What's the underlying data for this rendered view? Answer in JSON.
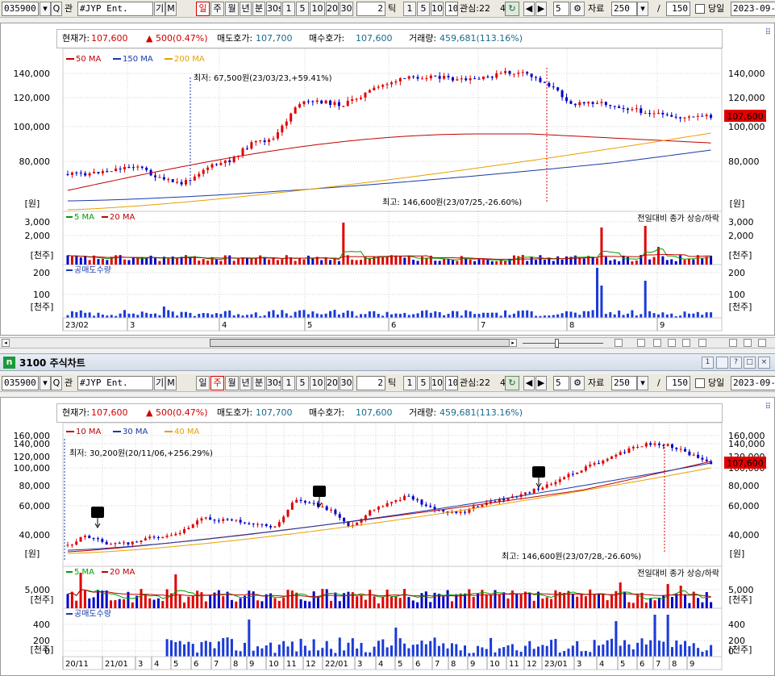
{
  "toolbar": {
    "code": "035900",
    "search_glyph": "Q",
    "search_label": "관",
    "name": "#JYP Ent.",
    "flag1": "기",
    "flag2": "M",
    "periods": [
      "일",
      "주",
      "월",
      "년",
      "분",
      "30s",
      "1",
      "5",
      "10",
      "20",
      "30"
    ],
    "tick_value": "2",
    "tick_label": "틱",
    "tick_buttons": [
      "1",
      "5",
      "10"
    ],
    "tick_input": "10",
    "interest": "관심:22",
    "interest_suffix": "4",
    "count": "5",
    "data_label": "자료",
    "data_value": "250",
    "slash": "/",
    "total": "150",
    "today_label": "당일",
    "date": "2023-09-1"
  },
  "chart1": {
    "period_selected": "일",
    "info": {
      "price_label": "현재가:",
      "price": "107,600",
      "change_arrow": "▲",
      "change": "500(0.47%)",
      "ask_label": "매도호가:",
      "ask": "107,700",
      "bid_label": "매수호가:",
      "bid": "107,600",
      "vol_label": "거래량:",
      "vol": "459,681(113.16%)"
    },
    "ma_legend": [
      {
        "label": "50 MA",
        "color": "#c00000"
      },
      {
        "label": "150 MA",
        "color": "#1a3aa8"
      },
      {
        "label": "200 MA",
        "color": "#e8a000"
      }
    ],
    "price_ticks": [
      "140,000",
      "120,000",
      "100,000",
      "80,000"
    ],
    "unit_won": "[원]",
    "current_tag": "107,600",
    "low_note": "최저: 67,500원(23/03/23,+59.41%)",
    "high_note": "최고: 146,600원(23/07/25,-26.60%)",
    "vol_legend": [
      {
        "label": "5 MA",
        "color": "#00a000"
      },
      {
        "label": "20 MA",
        "color": "#c00000"
      }
    ],
    "vol_right_note": "전일대비 종가 상승/하락",
    "vol_ticks": [
      "3,000",
      "2,000"
    ],
    "unit_thousand": "[천주]",
    "short_label": "공매도수량",
    "short_ticks": [
      "200",
      "100"
    ],
    "x_labels": [
      "23/02",
      "3",
      "4",
      "5",
      "6",
      "7",
      "8",
      "9"
    ]
  },
  "window": {
    "icon": "n",
    "title": "3100 주식차트",
    "buttons": [
      "1",
      "?",
      "□",
      "×"
    ]
  },
  "chart2": {
    "period_selected": "주",
    "info": {
      "price_label": "현재가:",
      "price": "107,600",
      "change_arrow": "▲",
      "change": "500(0.47%)",
      "ask_label": "매도호가:",
      "ask": "107,700",
      "bid_label": "매수호가:",
      "bid": "107,600",
      "vol_label": "거래량:",
      "vol": "459,681(113.16%)"
    },
    "ma_legend": [
      {
        "label": "10 MA",
        "color": "#c00000"
      },
      {
        "label": "30 MA",
        "color": "#1a3aa8"
      },
      {
        "label": "40 MA",
        "color": "#e8a000"
      }
    ],
    "price_ticks": [
      "160,000",
      "140,000",
      "120,000",
      "100,000",
      "80,000",
      "60,000",
      "40,000"
    ],
    "unit_won": "[원]",
    "current_tag": "107,600",
    "low_note": "최저: 30,200원(20/11/06,+256.29%)",
    "high_note": "최고: 146,600원(23/07/28,-26.60%)",
    "marker": "매",
    "vol_legend": [
      {
        "label": "5 MA",
        "color": "#00a000"
      },
      {
        "label": "20 MA",
        "color": "#c00000"
      }
    ],
    "vol_right_note": "전일대비 종가 상승/하락",
    "vol_ticks": [
      "5,000"
    ],
    "unit_thousand": "[천주]",
    "short_label": "공매도수량",
    "short_ticks": [
      "400",
      "200",
      "0"
    ],
    "x_labels": [
      "20/11",
      "21/01",
      "3",
      "4",
      "5",
      "6",
      "7",
      "8",
      "9",
      "10",
      "11",
      "12",
      "22/01",
      "3",
      "4",
      "5",
      "6",
      "7",
      "8",
      "9",
      "10",
      "11",
      "12",
      "23/01",
      "3",
      "4",
      "5",
      "6",
      "7",
      "8",
      "9"
    ]
  }
}
